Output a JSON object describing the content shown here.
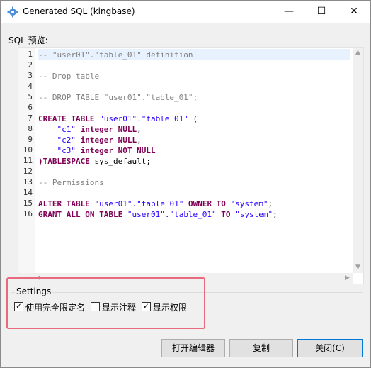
{
  "window": {
    "title": "Generated SQL (kingbase)",
    "minimize_glyph": "—",
    "maximize_glyph": "☐",
    "close_glyph": "✕"
  },
  "preview_label": "SQL 预览:",
  "code": {
    "line_numbers": [
      "1",
      "2",
      "3",
      "4",
      "5",
      "6",
      "7",
      "8",
      "9",
      "10",
      "11",
      "12",
      "13",
      "14",
      "15",
      "16"
    ],
    "lines": [
      [
        {
          "t": "comment",
          "v": "-- \"user01\".\"table_01\" definition"
        }
      ],
      [],
      [
        {
          "t": "comment",
          "v": "-- Drop table"
        }
      ],
      [],
      [
        {
          "t": "comment",
          "v": "-- DROP TABLE \"user01\".\"table_01\";"
        }
      ],
      [],
      [
        {
          "t": "keyword",
          "v": "CREATE TABLE "
        },
        {
          "t": "string",
          "v": "\"user01\".\"table_01\""
        },
        {
          "t": "plain",
          "v": " ("
        }
      ],
      [
        {
          "t": "plain",
          "v": "    "
        },
        {
          "t": "string",
          "v": "\"c1\""
        },
        {
          "t": "plain",
          "v": " "
        },
        {
          "t": "keyword",
          "v": "integer NULL"
        },
        {
          "t": "plain",
          "v": ","
        }
      ],
      [
        {
          "t": "plain",
          "v": "    "
        },
        {
          "t": "string",
          "v": "\"c2\""
        },
        {
          "t": "plain",
          "v": " "
        },
        {
          "t": "keyword",
          "v": "integer NULL"
        },
        {
          "t": "plain",
          "v": ","
        }
      ],
      [
        {
          "t": "plain",
          "v": "    "
        },
        {
          "t": "string",
          "v": "\"c3\""
        },
        {
          "t": "plain",
          "v": " "
        },
        {
          "t": "keyword",
          "v": "integer NOT NULL"
        }
      ],
      [
        {
          "t": "keyword",
          "v": ")TABLESPACE"
        },
        {
          "t": "plain",
          "v": " sys_default;"
        }
      ],
      [],
      [
        {
          "t": "comment",
          "v": "-- Permissions"
        }
      ],
      [],
      [
        {
          "t": "keyword",
          "v": "ALTER TABLE "
        },
        {
          "t": "string",
          "v": "\"user01\".\"table_01\""
        },
        {
          "t": "keyword",
          "v": " OWNER TO "
        },
        {
          "t": "string",
          "v": "\"system\""
        },
        {
          "t": "plain",
          "v": ";"
        }
      ],
      [
        {
          "t": "keyword",
          "v": "GRANT ALL ON TABLE "
        },
        {
          "t": "string",
          "v": "\"user01\".\"table_01\""
        },
        {
          "t": "keyword",
          "v": " TO "
        },
        {
          "t": "string",
          "v": "\"system\""
        },
        {
          "t": "plain",
          "v": ";"
        }
      ]
    ]
  },
  "settings": {
    "title": "Settings",
    "options": [
      {
        "label": "使用完全限定名",
        "checked": true
      },
      {
        "label": "显示注释",
        "checked": false
      },
      {
        "label": "显示权限",
        "checked": true
      }
    ]
  },
  "buttons": {
    "open_editor": "打开编辑器",
    "copy": "复制",
    "close": "关闭(C)"
  },
  "colors": {
    "comment": "#808080",
    "keyword": "#7f0055",
    "string": "#2a00ff",
    "highlight_border": "#e86a7c",
    "primary_border": "#0078d7"
  },
  "icons": {
    "title": "gear-icon",
    "scroll_left": "chevron-left-icon",
    "scroll_right": "chevron-right-icon",
    "scroll_up": "chevron-up-icon",
    "scroll_down": "chevron-down-icon"
  }
}
